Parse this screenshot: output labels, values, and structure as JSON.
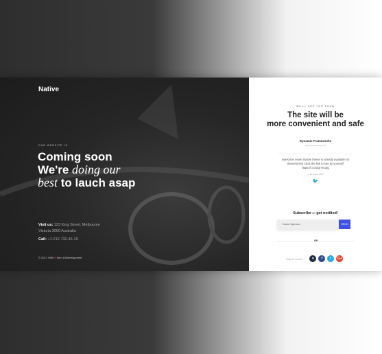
{
  "left": {
    "brand": "Native",
    "kicker": "OUR WEBSITE IS",
    "line1": "Coming soon",
    "line2a": "We're ",
    "line2b": "doing our",
    "line3a": "best",
    "line3b": " to lauch asap",
    "visit_label": "Visit us:",
    "visit_text": "123 King Street, Melbourne",
    "visit_text2": "Victoria 3000 Australia",
    "call_label": "Call:",
    "call_text": "+1-212-732-46-19",
    "footer_a": "© 2017 With",
    "footer_b": "from DIDevelopment"
  },
  "right": {
    "kicker": "WE'LL SEE YOU SOON",
    "title1": "The site will be",
    "title2": "more convenient and safe",
    "card_title": "Dynamic Frameworks",
    "card_sub": "@dynamicframeworks",
    "card_body": "Awesome news! Native theme is already available on themeforest! Click the link to see by yourself https://t.co/oQrTecdjg",
    "card_date": "19 March 2017",
    "subscribe_a": "Subscribe",
    "subscribe_b": "to",
    "subscribe_c": "get notified!",
    "input_value": "David Spencer",
    "button": "SEND",
    "or": "OR",
    "social_label": "Stay in touch :",
    "social": [
      {
        "icon": "vimeo-icon",
        "glyph": "v",
        "color": "#1e2f44"
      },
      {
        "icon": "facebook-icon",
        "glyph": "f",
        "color": "#2d4a8a"
      },
      {
        "icon": "twitter-icon",
        "glyph": "t",
        "color": "#28a9e8"
      },
      {
        "icon": "google-plus-icon",
        "glyph": "G+",
        "color": "#e0442c"
      }
    ]
  }
}
